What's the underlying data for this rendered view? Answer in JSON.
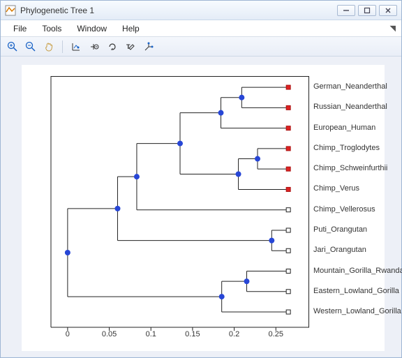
{
  "window": {
    "title": "Phylogenetic Tree 1"
  },
  "menu": {
    "file": "File",
    "tools": "Tools",
    "window": "Window",
    "help": "Help"
  },
  "chart_data": {
    "type": "dendrogram",
    "xlabel": "",
    "ylabel": "",
    "xlim": [
      -0.02,
      0.29
    ],
    "ticks": [
      0,
      0.05,
      0.1,
      0.15,
      0.2,
      0.25
    ],
    "leaves": [
      {
        "name": "German_Neanderthal",
        "x": 0.265,
        "marker": "red"
      },
      {
        "name": "Russian_Neanderthal",
        "x": 0.265,
        "marker": "red"
      },
      {
        "name": "European_Human",
        "x": 0.265,
        "marker": "red"
      },
      {
        "name": "Chimp_Troglodytes",
        "x": 0.265,
        "marker": "red"
      },
      {
        "name": "Chimp_Schweinfurthii",
        "x": 0.265,
        "marker": "red"
      },
      {
        "name": "Chimp_Verus",
        "x": 0.265,
        "marker": "red"
      },
      {
        "name": "Chimp_Vellerosus",
        "x": 0.265,
        "marker": "open"
      },
      {
        "name": "Puti_Orangutan",
        "x": 0.265,
        "marker": "open"
      },
      {
        "name": "Jari_Orangutan",
        "x": 0.265,
        "marker": "open"
      },
      {
        "name": "Mountain_Gorilla_Rwanda",
        "x": 0.265,
        "marker": "open"
      },
      {
        "name": "Eastern_Lowland_Gorilla",
        "x": 0.265,
        "marker": "open"
      },
      {
        "name": "Western_Lowland_Gorilla",
        "x": 0.265,
        "marker": "open"
      }
    ],
    "internal_nodes": [
      {
        "x": 0.209,
        "children": [
          0,
          1
        ]
      },
      {
        "x": 0.184,
        "children": [
          "n0",
          2
        ]
      },
      {
        "x": 0.228,
        "children": [
          3,
          4
        ]
      },
      {
        "x": 0.205,
        "children": [
          "n2",
          5
        ]
      },
      {
        "x": 0.135,
        "children": [
          "n1",
          "n3"
        ]
      },
      {
        "x": 0.083,
        "children": [
          "n4",
          6
        ]
      },
      {
        "x": 0.245,
        "children": [
          7,
          8
        ]
      },
      {
        "x": 0.06,
        "children": [
          "n5",
          "n6"
        ]
      },
      {
        "x": 0.215,
        "children": [
          9,
          10
        ]
      },
      {
        "x": 0.185,
        "children": [
          "n8",
          11
        ]
      },
      {
        "x": 0.0,
        "children": [
          "n7",
          "n9"
        ]
      }
    ]
  },
  "ticklabels": [
    "0",
    "0.05",
    "0.1",
    "0.15",
    "0.2",
    "0.25"
  ]
}
